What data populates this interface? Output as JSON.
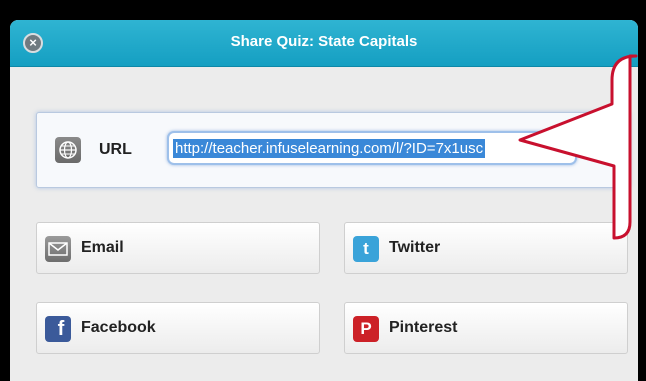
{
  "dialog": {
    "title": "Share Quiz: State Capitals",
    "close_icon": "close-icon"
  },
  "url_panel": {
    "label": "URL",
    "icon": "globe-icon",
    "value": "http://teacher.infuselearning.com/l/?ID=7x1usc"
  },
  "share_buttons": [
    {
      "label": "Email",
      "icon": "email-icon"
    },
    {
      "label": "Twitter",
      "icon": "twitter-icon"
    },
    {
      "label": "Facebook",
      "icon": "facebook-icon"
    },
    {
      "label": "Pinterest",
      "icon": "pinterest-icon"
    }
  ],
  "colors": {
    "titlebar": "#159fc2",
    "callout_border": "#c8102e",
    "selection": "#3a88d8"
  }
}
